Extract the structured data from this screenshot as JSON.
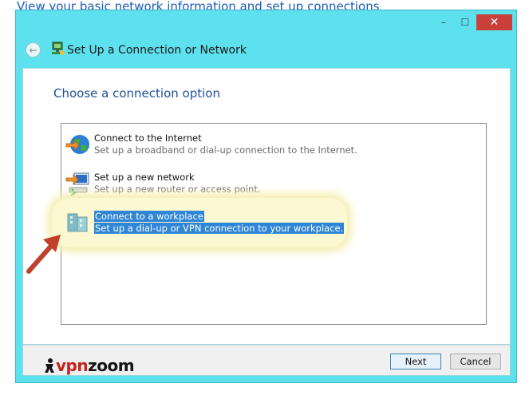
{
  "background": {
    "heading": "View your basic network information and set up connections"
  },
  "window": {
    "title": "Set Up a Connection or Network",
    "controls": {
      "minimize": "–",
      "maximize": "☐",
      "close": "✕"
    },
    "back_icon": "back-arrow-icon",
    "accent_color": "#5ee1ee"
  },
  "main": {
    "heading": "Choose a connection option",
    "options": [
      {
        "title": "Connect to the Internet",
        "description": "Set up a broadband or dial-up connection to the Internet.",
        "icon": "globe-icon"
      },
      {
        "title": "Set up a new network",
        "description": "Set up a new router or access point.",
        "icon": "router-icon"
      },
      {
        "title": "Connect to a workplace",
        "description": "Set up a dial-up or VPN connection to your workplace.",
        "icon": "workplace-icon",
        "selected": true
      }
    ]
  },
  "footer": {
    "next_label": "Next",
    "cancel_label": "Cancel",
    "logo": {
      "prefix": "vpn",
      "suffix": "zoom"
    }
  },
  "annotation": {
    "icon": "pointer-arrow-icon",
    "color": "#c0402c"
  }
}
